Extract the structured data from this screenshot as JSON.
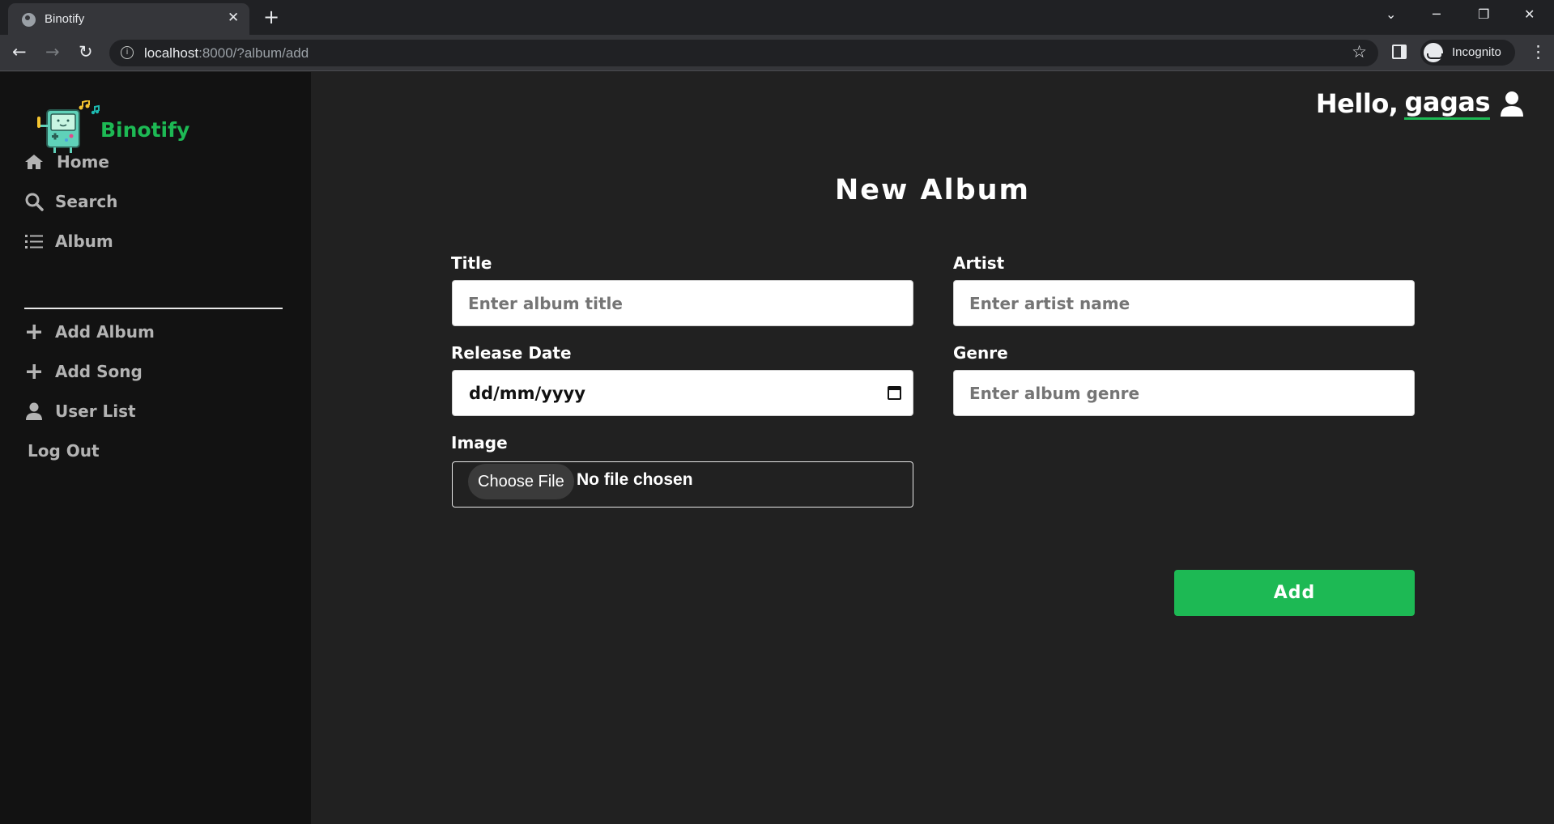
{
  "browser": {
    "tab_title": "Binotify",
    "tab_close_glyph": "✕",
    "new_tab_glyph": "+",
    "url_host": "localhost",
    "url_path": ":8000/?album/add",
    "incognito_label": "Incognito"
  },
  "sidebar": {
    "brand": "Binotify",
    "items": [
      {
        "label": "Home",
        "icon": "home-icon"
      },
      {
        "label": "Search",
        "icon": "search-icon"
      },
      {
        "label": "Album",
        "icon": "list-icon"
      }
    ],
    "admin_items": [
      {
        "label": "Add Album",
        "icon": "plus-icon"
      },
      {
        "label": "Add Song",
        "icon": "plus-icon"
      },
      {
        "label": "User List",
        "icon": "user-icon"
      }
    ],
    "logout": "Log Out"
  },
  "header": {
    "greeting": "Hello,",
    "username": "gagas"
  },
  "form": {
    "title": "New Album",
    "title_label": "Title",
    "title_placeholder": "Enter album title",
    "artist_label": "Artist",
    "artist_placeholder": "Enter artist name",
    "release_label": "Release Date",
    "release_placeholder": "dd/mm/yyyy",
    "genre_label": "Genre",
    "genre_placeholder": "Enter album genre",
    "image_label": "Image",
    "file_button": "Choose File",
    "file_status": "No file chosen",
    "submit": "Add"
  },
  "colors": {
    "accent": "#1db954",
    "sidebar_bg": "#121212",
    "main_bg": "#212121"
  }
}
